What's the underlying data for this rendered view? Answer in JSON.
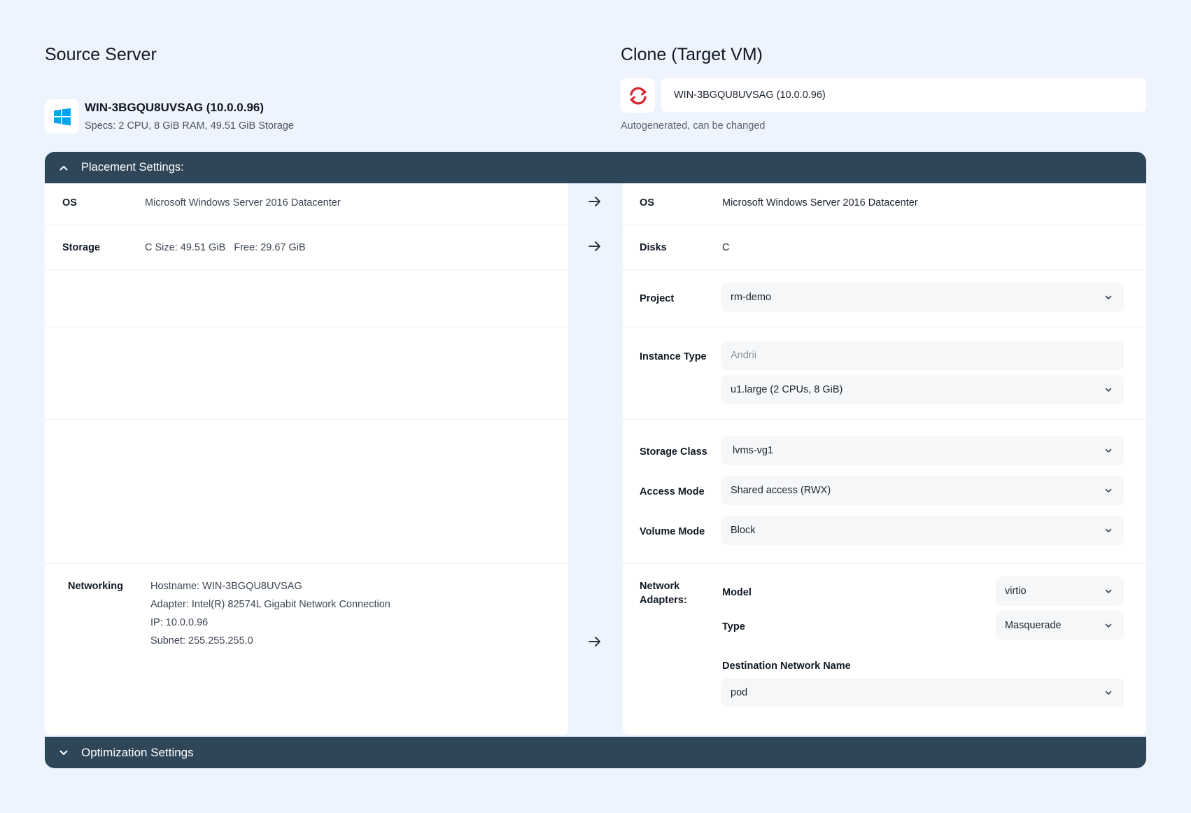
{
  "source": {
    "title": "Source Server",
    "server_name": "WIN-3BGQU8UVSAG (10.0.0.96)",
    "specs": "Specs: 2 CPU, 8 GiB RAM, 49.51 GiB Storage",
    "os_icon": "windows-logo-icon"
  },
  "target": {
    "title": "Clone (Target VM)",
    "name_value": "WIN-3BGQU8UVSAG (10.0.0.96)",
    "name_hint": "Autogenerated, can be changed",
    "icon": "openshift-refresh-icon"
  },
  "placement": {
    "label": "Placement Settings:",
    "source": {
      "os_label": "OS",
      "os_value": "Microsoft Windows Server 2016 Datacenter",
      "storage_label": "Storage",
      "storage_value": "C Size: 49.51 GiB   Free: 29.67 GiB",
      "networking_label": "Networking",
      "networking_lines": [
        "Hostname: WIN-3BGQU8UVSAG",
        "Adapter: Intel(R) 82574L Gigabit Network Connection",
        "IP: 10.0.0.96",
        "Subnet: 255.255.255.0"
      ]
    },
    "target": {
      "os_label": "OS",
      "os_value": "Microsoft Windows Server 2016 Datacenter",
      "disks_label": "Disks",
      "disks_value": "C",
      "project_label": "Project",
      "project_value": "rm-demo",
      "instance_type_label": "Instance Type",
      "instance_type_placeholder": "Andrii",
      "instance_type_value": "u1.large (2 CPUs, 8 GiB)",
      "storage_class_label": "Storage Class",
      "storage_class_value": "lvms-vg1",
      "access_mode_label": "Access Mode",
      "access_mode_value": "Shared access (RWX)",
      "volume_mode_label": "Volume Mode",
      "volume_mode_value": "Block",
      "network_adapters_label": "Network Adapters:",
      "model_label": "Model",
      "model_value": "virtio",
      "type_label": "Type",
      "type_value": "Masquerade",
      "dest_network_label": "Destination Network Name",
      "dest_network_value": "pod"
    }
  },
  "optimization": {
    "label": "Optimization Settings"
  },
  "colors": {
    "background": "#eef4fd",
    "bar": "#2f4558",
    "windows_blue": "#00a4ef",
    "openshift_red": "#d7262f"
  }
}
